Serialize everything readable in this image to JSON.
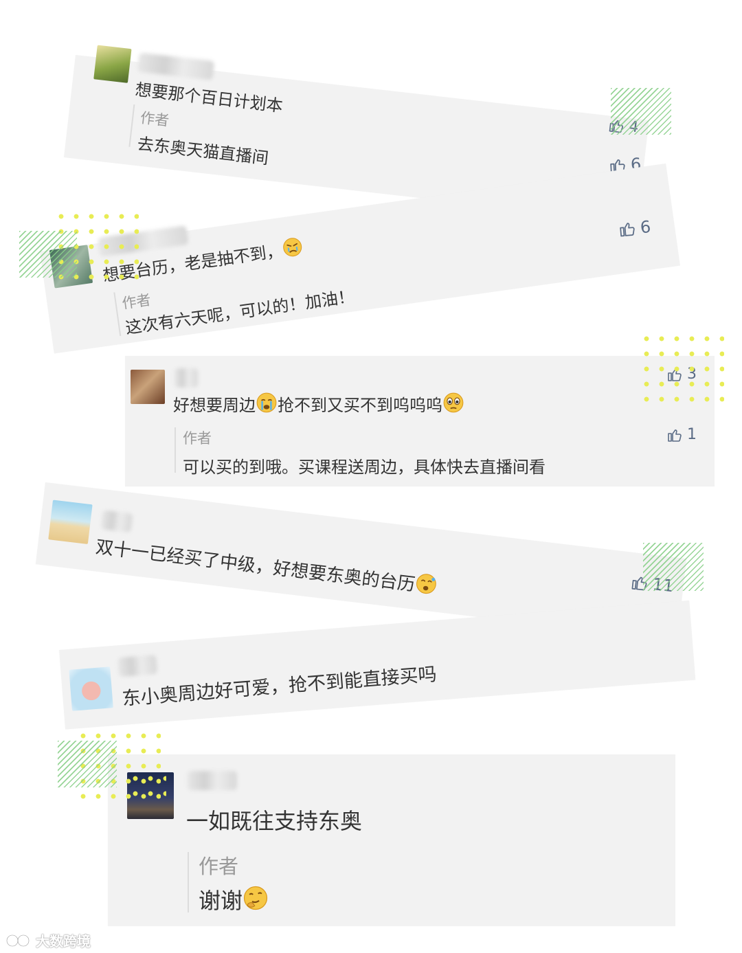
{
  "comments": [
    {
      "text": "想要那个百日计划本",
      "author_label": "作者",
      "reply": "去东奥天猫直播间",
      "comment_likes": "4",
      "reply_likes": "6"
    },
    {
      "text": "想要台历，老是抽不到，",
      "author_label": "作者",
      "reply": "这次有六天呢，可以的！加油！",
      "comment_likes": "6"
    },
    {
      "text": "好想要周边",
      "text_mid": "抢不到又买不到呜呜呜",
      "author_label": "作者",
      "reply": "可以买的到哦。买课程送周边，具体快去直播间看",
      "comment_likes": "3",
      "reply_likes": "1"
    },
    {
      "text": "双十一已经买了中级，好想要东奥的台历",
      "comment_likes": "11"
    },
    {
      "text": "东小奥周边好可爱，抢不到能直接买吗"
    },
    {
      "text": "一如既往支持东奥",
      "author_label": "作者",
      "reply": "谢谢"
    }
  ],
  "icons": {
    "like": "thumbs-up-icon",
    "emoji_angry_cry": "angry-crying-emoji",
    "emoji_crying": "crying-emoji",
    "emoji_teary": "teary-eyed-emoji",
    "emoji_sweat": "sweat-smile-emoji",
    "emoji_hmm": "thinking-emoji"
  },
  "colors": {
    "card_bg": "#f2f2f2",
    "like_icon": "#5a6b85",
    "author_label": "#999999",
    "deco_stripe": "#8bd08b",
    "deco_dots": "#e8ec55"
  },
  "watermark": "大数跨境"
}
